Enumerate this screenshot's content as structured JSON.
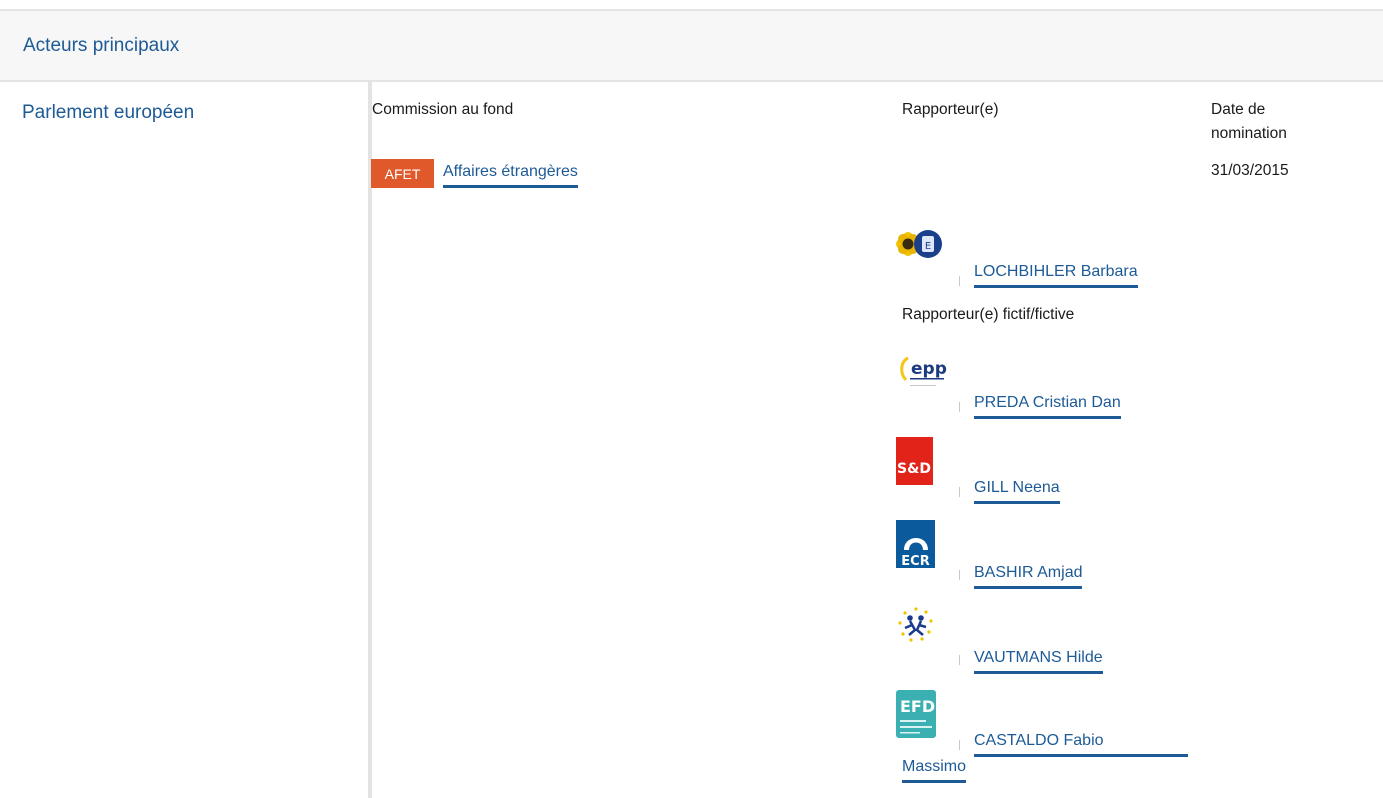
{
  "section": {
    "title": "Acteurs principaux"
  },
  "institution": "Parlement européen",
  "columns": {
    "committee": "Commission au fond",
    "rapporteur": "Rapporteur(e)",
    "date_line1": "Date de",
    "date_line2": "nomination"
  },
  "committee": {
    "badge": "AFET",
    "name": "Affaires étrangères",
    "badge_color": "#e0592a"
  },
  "date": "31/03/2015",
  "rapporteur": {
    "name": "LOCHBIHLER Barbara",
    "group_icon": "greens-efa-logo"
  },
  "shadow": {
    "heading": "Rapporteur(e) fictif/fictive",
    "items": [
      {
        "name": "PREDA Cristian Dan",
        "group_icon": "epp-logo"
      },
      {
        "name": "GILL Neena",
        "group_icon": "s-and-d-logo"
      },
      {
        "name": "BASHIR Amjad",
        "group_icon": "ecr-logo"
      },
      {
        "name": "VAUTMANS Hilde",
        "group_icon": "alde-logo"
      },
      {
        "name_line1": "CASTALDO Fabio",
        "name_line2": "Massimo",
        "group_icon": "efdd-logo"
      }
    ]
  },
  "logos": {
    "epp": "epp",
    "snd": "S&D",
    "ecr": "ECR",
    "efd": "EFD"
  },
  "colors": {
    "link": "#1d5a96",
    "badge": "#e0592a",
    "snd": "#e2231a",
    "ecr": "#0a5a9c",
    "efd": "#3ab0b3"
  }
}
